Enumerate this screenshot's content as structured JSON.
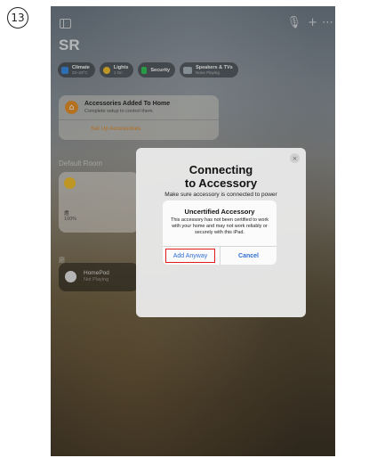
{
  "step_number": "13",
  "top_bar": {
    "sidebar_icon": "sidebar-icon",
    "mic_icon": "microphone-icon",
    "add_icon": "+",
    "more_icon": "ellipsis-icon"
  },
  "home": {
    "title": "SR",
    "chips": [
      {
        "title": "Climate",
        "sub": "22–23°C",
        "icon": "thermometer-icon",
        "color": "#3a8ee6"
      },
      {
        "title": "Lights",
        "sub": "1 On",
        "icon": "lightbulb-icon",
        "color": "#f2c12e"
      },
      {
        "title": "Security",
        "sub": "",
        "icon": "lock-icon",
        "color": "#34c759"
      },
      {
        "title": "Speakers & TVs",
        "sub": "None Playing",
        "icon": "tv-icon",
        "color": "#aab4be"
      }
    ],
    "card": {
      "title": "Accessories Added To Home",
      "subtitle": "Complete setup to control them.",
      "link": "Set Up Accessories"
    },
    "room_title": "Default Room",
    "tile": {
      "name": "燈",
      "value": "100%"
    },
    "room2_title": "廳",
    "homepod": {
      "name": "HomePod",
      "status": "Not Playing"
    }
  },
  "sheet": {
    "title": "Connecting\nto Accessory",
    "subtitle": "Make sure accessory is connected to power",
    "close": "×"
  },
  "alert": {
    "title": "Uncertified Accessory",
    "body": "This accessory has not been certified to work with your home and may not work reliably or securely with this iPad.",
    "add_button": "Add Anyway",
    "cancel_button": "Cancel"
  },
  "colors": {
    "accent_orange": "#e38a24",
    "link_blue": "#2f6fd6",
    "highlight_red": "#e21b1b"
  }
}
